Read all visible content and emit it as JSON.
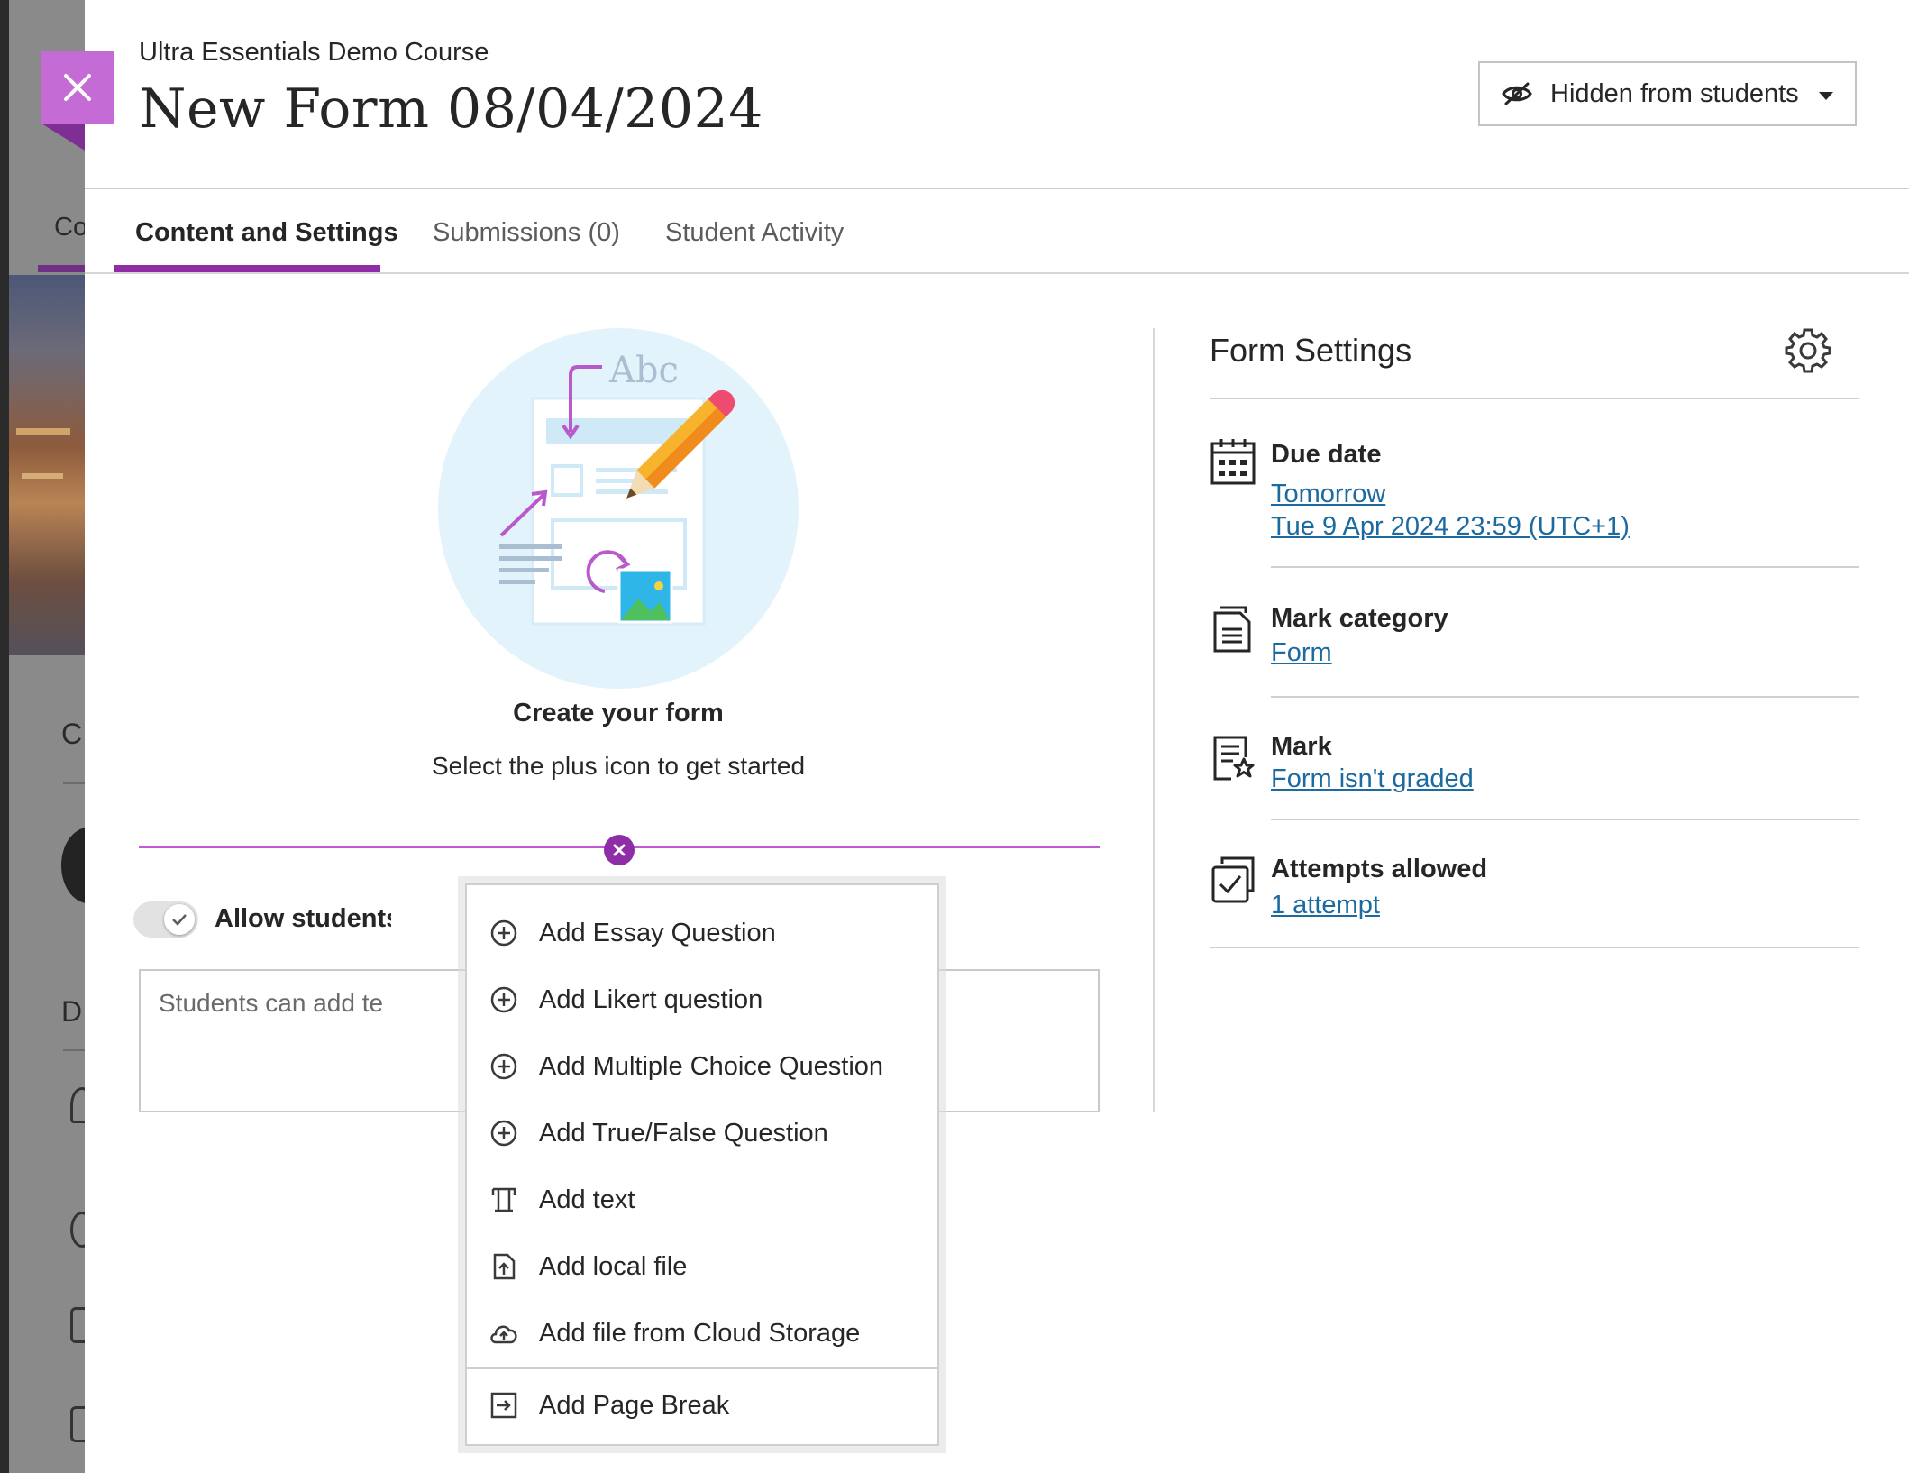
{
  "header": {
    "course_name": "Ultra Essentials Demo Course",
    "page_title": "New Form 08/04/2024",
    "visibility_label": "Hidden from students"
  },
  "tabs": [
    {
      "label": "Content and Settings",
      "active": true
    },
    {
      "label": "Submissions (0)",
      "active": false
    },
    {
      "label": "Student Activity",
      "active": false
    }
  ],
  "empty_state": {
    "illustration_text": "Abc",
    "title": "Create your form",
    "subtitle": "Select the plus icon to get started"
  },
  "allow_students": {
    "label": "Allow students",
    "toggle_on": true,
    "placeholder": "Students can add te"
  },
  "form_settings": {
    "title": "Form Settings",
    "items": [
      {
        "label": "Due date",
        "links": [
          "Tomorrow",
          "Tue 9 Apr 2024 23:59 (UTC+1)"
        ],
        "icon": "calendar-icon"
      },
      {
        "label": "Mark category",
        "links": [
          "Form"
        ],
        "icon": "document-icon"
      },
      {
        "label": "Mark",
        "links": [
          "Form isn't graded"
        ],
        "icon": "graded-doc-icon"
      },
      {
        "label": "Attempts allowed",
        "links": [
          "1 attempt"
        ],
        "icon": "attempts-icon"
      }
    ]
  },
  "add_menu": {
    "items": [
      {
        "label": "Add Essay Question",
        "icon": "plus-circle-icon"
      },
      {
        "label": "Add Likert question",
        "icon": "plus-circle-icon"
      },
      {
        "label": "Add Multiple Choice Question",
        "icon": "plus-circle-icon"
      },
      {
        "label": "Add True/False Question",
        "icon": "plus-circle-icon"
      },
      {
        "label": "Add text",
        "icon": "text-icon"
      },
      {
        "label": "Add local file",
        "icon": "file-upload-icon"
      },
      {
        "label": "Add file from Cloud Storage",
        "icon": "cloud-upload-icon"
      },
      {
        "label": "Add Page Break",
        "icon": "page-break-icon"
      }
    ]
  },
  "backdrop": {
    "letters": [
      "Co",
      "C",
      "D"
    ]
  },
  "colors": {
    "accent_purple": "#8e2da5",
    "close_button": "#c56bd6",
    "link_blue": "#1c6aa0",
    "insert_line": "#c25ad6"
  }
}
